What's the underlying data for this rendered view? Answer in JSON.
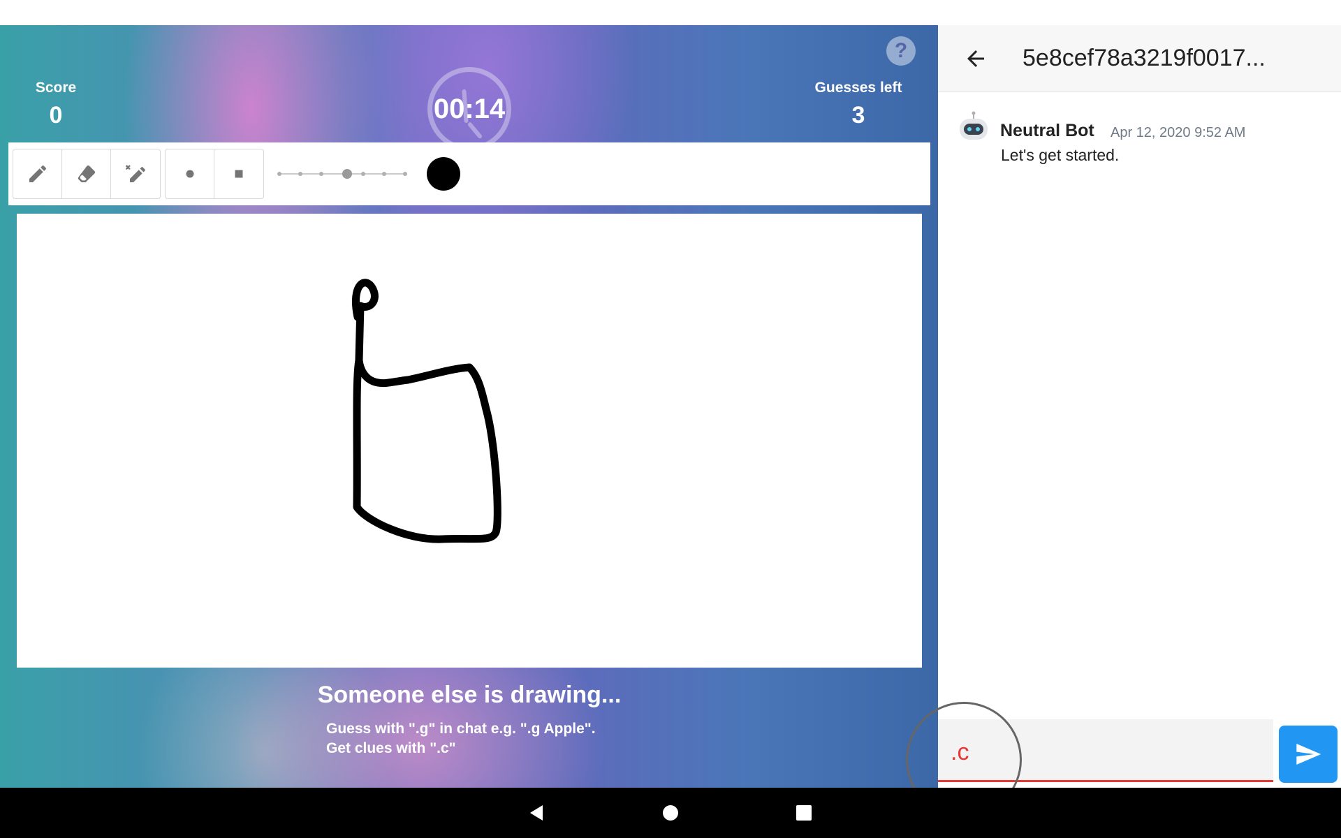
{
  "game": {
    "score_label": "Score",
    "score_value": "0",
    "timer": "00:14",
    "guesses_label": "Guesses left",
    "guesses_value": "3",
    "help_symbol": "?",
    "status_title": "Someone else is drawing...",
    "hint_guess": "Guess with \".g\" in chat e.g. \".g Apple\".",
    "hint_clue": "Get clues with \".c\"",
    "brush_size_steps": 7,
    "brush_size_selected": 4,
    "brush_color": "#000000",
    "tools": [
      "pencil-icon",
      "eraser-icon",
      "clear-icon",
      "round-brush-icon",
      "square-brush-icon"
    ]
  },
  "chat": {
    "title": "5e8cef78a3219f0017...",
    "messages": [
      {
        "author": "Neutral Bot",
        "time": "Apr 12, 2020 9:52 AM",
        "text": "Let's get started."
      }
    ],
    "input_value": ".c",
    "accent_color": "#e53935",
    "send_color": "#2196f3"
  }
}
